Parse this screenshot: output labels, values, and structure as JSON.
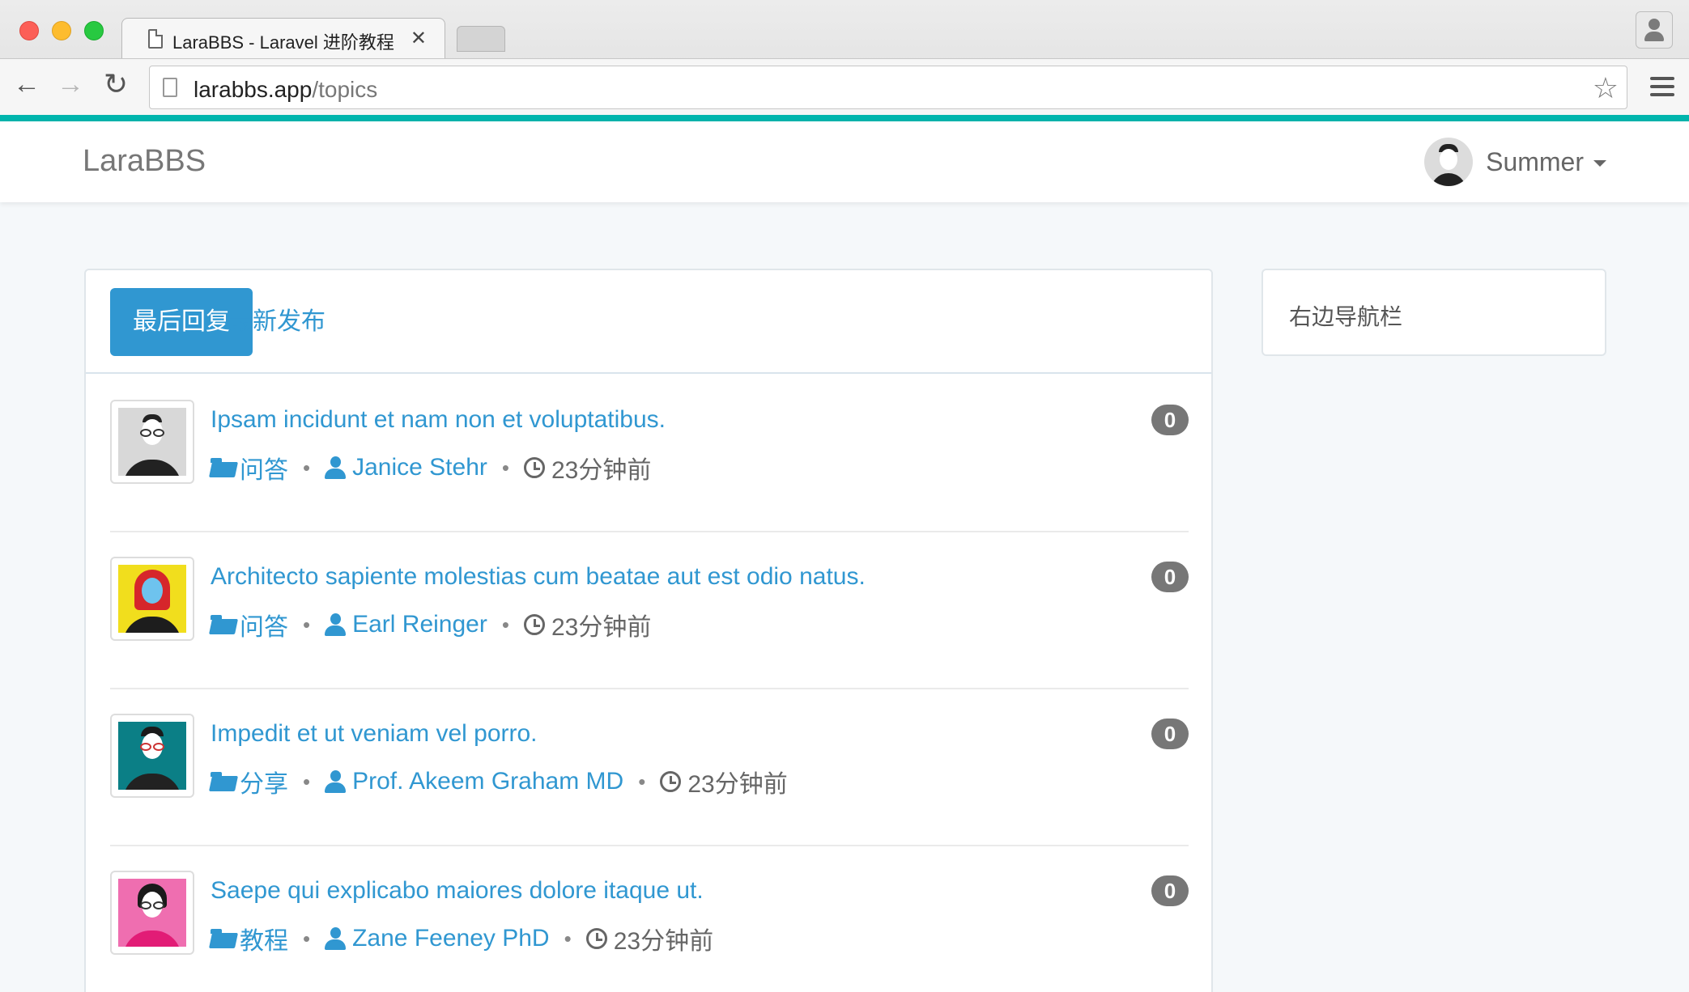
{
  "browser": {
    "tab_title": "LaraBBS - Laravel 进阶教程",
    "tab_close": "✕",
    "url_host": "larabbs.app",
    "url_path": "/topics",
    "back_glyph": "←",
    "forward_glyph": "→",
    "reload_glyph": "↻",
    "star_glyph": "☆"
  },
  "navbar": {
    "brand": "LaraBBS",
    "user_name": "Summer"
  },
  "tabs": [
    {
      "label": "最后回复",
      "active": true
    },
    {
      "label": "最新发布",
      "active": false
    }
  ],
  "topics": [
    {
      "title": "Ipsam incidunt et nam non et voluptatibus.",
      "category": "问答",
      "author": "Janice Stehr",
      "time": "23分钟前",
      "reply_count": "0",
      "avatar_bg": "#d8d8d8"
    },
    {
      "title": "Architecto sapiente molestias cum beatae aut est odio natus.",
      "category": "问答",
      "author": "Earl Reinger",
      "time": "23分钟前",
      "reply_count": "0",
      "avatar_bg": "#f1de1d"
    },
    {
      "title": "Impedit et ut veniam vel porro.",
      "category": "分享",
      "author": "Prof. Akeem Graham MD",
      "time": "23分钟前",
      "reply_count": "0",
      "avatar_bg": "#0b7f86"
    },
    {
      "title": "Saepe qui explicabo maiores dolore itaque ut.",
      "category": "教程",
      "author": "Zane Feeney PhD",
      "time": "23分钟前",
      "reply_count": "0",
      "avatar_bg": "#ef6eb0"
    }
  ],
  "sidebar": {
    "title": "右边导航栏"
  },
  "colors": {
    "accent_line": "#00b5ad",
    "link": "#3097d1",
    "badge": "#777777"
  }
}
